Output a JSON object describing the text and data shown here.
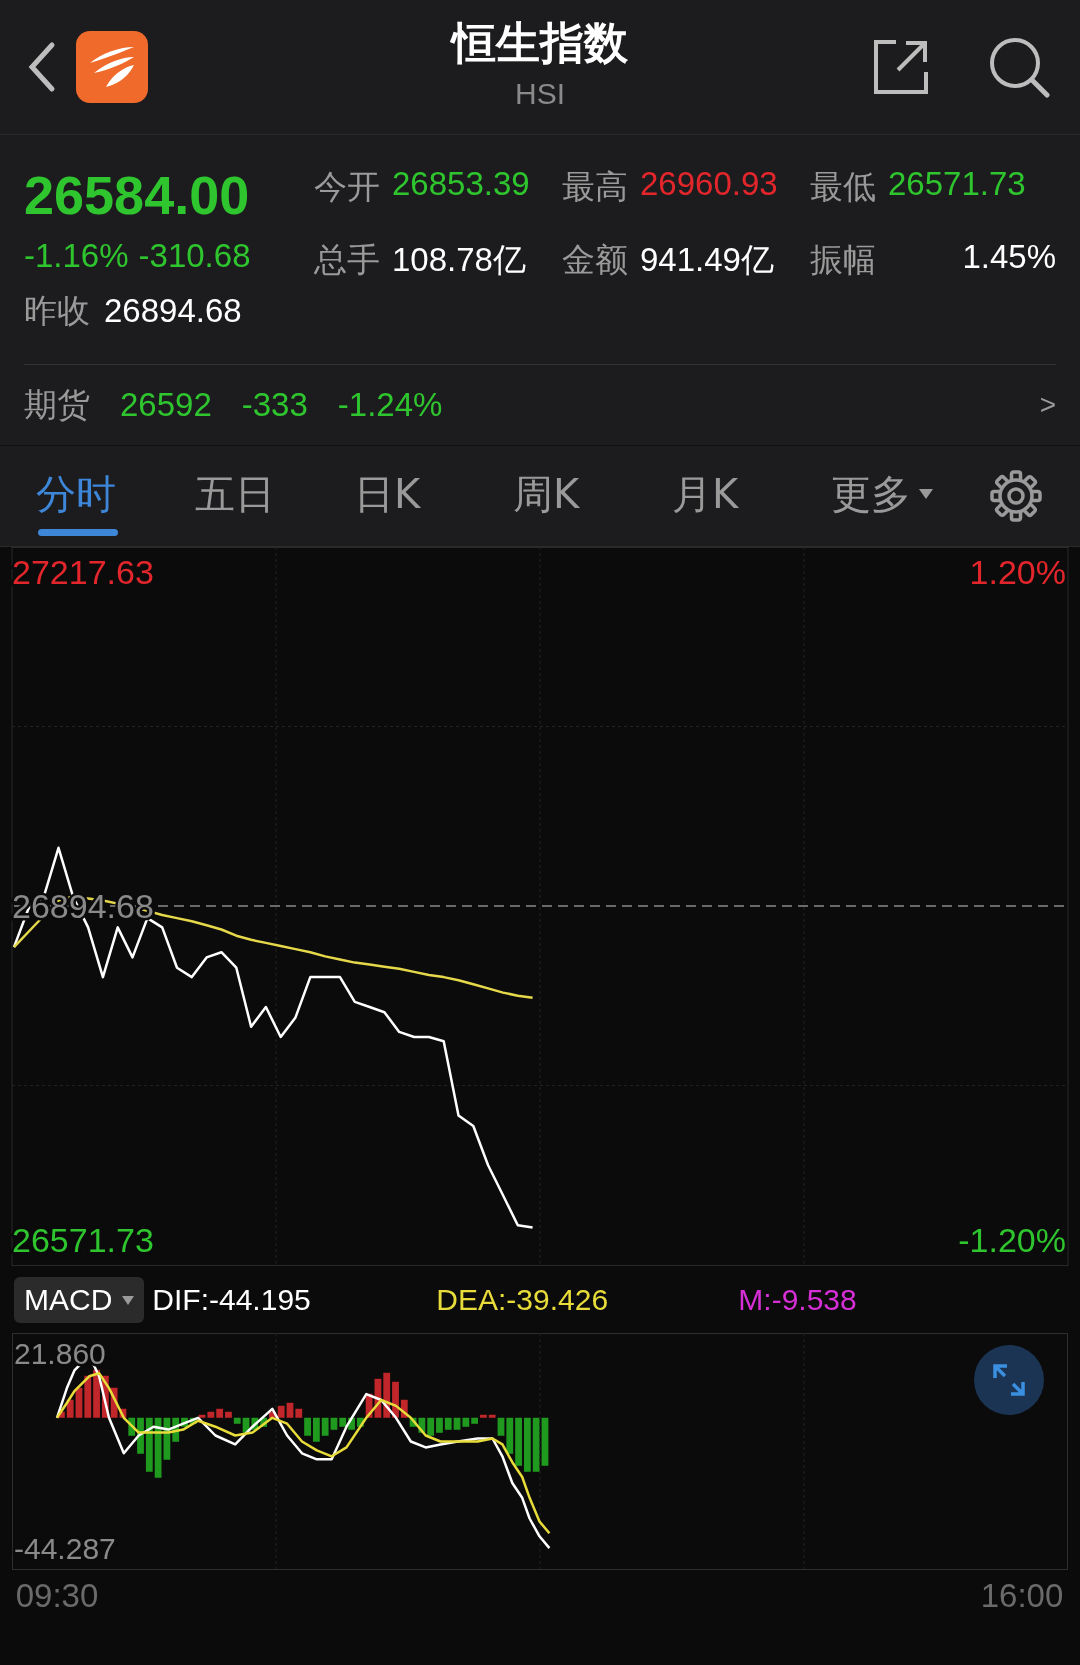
{
  "header": {
    "title": "恒生指数",
    "subtitle": "HSI"
  },
  "quote": {
    "price": "26584.00",
    "change_pct": "-1.16%",
    "change": "-310.68",
    "color": "#2ec52e",
    "prev_close_label": "昨收",
    "prev_close": "26894.68",
    "stats": [
      {
        "label": "今开",
        "value": "26853.39",
        "color": "#2ec52e"
      },
      {
        "label": "最高",
        "value": "26960.93",
        "color": "#e3262b"
      },
      {
        "label": "最低",
        "value": "26571.73",
        "color": "#2ec52e"
      },
      {
        "label": "总手",
        "value": "108.78亿",
        "color": "#ffffff"
      },
      {
        "label": "金额",
        "value": "941.49亿",
        "color": "#ffffff"
      },
      {
        "label": "振幅",
        "value": "1.45%",
        "color": "#ffffff"
      }
    ]
  },
  "futures": {
    "label": "期货",
    "price": "26592",
    "change": "-333",
    "change_pct": "-1.24%",
    "color": "#2ec52e",
    "arrow": ">"
  },
  "tabs": [
    {
      "label": "分时",
      "selected": true,
      "dropdown": false
    },
    {
      "label": "五日",
      "selected": false,
      "dropdown": false
    },
    {
      "label": "日K",
      "selected": false,
      "dropdown": false
    },
    {
      "label": "周K",
      "selected": false,
      "dropdown": false
    },
    {
      "label": "月K",
      "selected": false,
      "dropdown": false
    },
    {
      "label": "更多",
      "selected": false,
      "dropdown": true
    }
  ],
  "price_chart": {
    "chart_data": {
      "type": "line",
      "ylim": [
        26547.6,
        27241.8
      ],
      "categories": [
        null,
        null,
        null,
        null,
        null,
        null,
        null,
        null,
        null,
        null,
        null,
        null,
        null,
        null,
        null,
        null,
        null,
        null,
        null,
        null,
        null,
        null,
        null,
        null,
        null,
        null,
        null,
        null,
        null,
        null,
        null,
        null,
        null,
        null,
        null,
        null,
        null,
        null,
        null,
        null,
        null,
        null,
        null,
        null,
        null,
        null,
        null,
        null,
        null,
        null,
        null,
        null,
        null,
        null,
        null,
        null,
        null,
        null,
        null,
        null,
        null,
        null,
        null,
        null,
        null,
        null,
        null,
        null,
        null,
        null,
        null,
        null
      ],
      "series": [
        {
          "color": "#ffffff",
          "values": [
            26855,
            26893,
            26903,
            26951,
            26903,
            26874,
            26826,
            26874,
            26845,
            26883,
            26874,
            26835,
            26826,
            26845,
            26850,
            26835,
            26778,
            26797,
            26768,
            26787,
            26826,
            26826,
            26826,
            26802,
            26797,
            26792,
            26773,
            26768,
            26768,
            26764,
            26692,
            26682,
            26644,
            26615,
            26586,
            26584,
            null,
            null,
            null,
            null,
            null,
            null,
            null,
            null,
            null,
            null,
            null,
            null,
            null,
            null,
            null,
            null,
            null,
            null,
            null,
            null,
            null,
            null,
            null,
            null,
            null,
            null,
            null,
            null,
            null,
            null,
            null,
            null,
            null,
            null,
            null,
            null
          ]
        },
        {
          "color": "#e5d84a",
          "values": [
            26855,
            26870,
            26885,
            26900,
            26904,
            26902,
            26900,
            26897,
            26894,
            26890,
            26886,
            26883,
            26880,
            26876,
            26872,
            26866,
            26862,
            26859,
            26856,
            26853,
            26850,
            26846,
            26843,
            26840,
            26838,
            26836,
            26834,
            26831,
            26828,
            26826,
            26823,
            26819,
            26815,
            26811,
            26808,
            26806,
            null,
            null,
            null,
            null,
            null,
            null,
            null,
            null,
            null,
            null,
            null,
            null,
            null,
            null,
            null,
            null,
            null,
            null,
            null,
            null,
            null,
            null,
            null,
            null,
            null,
            null,
            null,
            null,
            null,
            null,
            null,
            null,
            null,
            null,
            null,
            null
          ]
        },
        {
          "color": "#8a8a8a",
          "line_style": "dashed",
          "values": [
            26894.68,
            26894.68,
            26894.68,
            26894.68,
            26894.68,
            26894.68,
            26894.68,
            26894.68,
            26894.68,
            26894.68,
            26894.68,
            26894.68,
            26894.68,
            26894.68,
            26894.68,
            26894.68,
            26894.68,
            26894.68,
            26894.68,
            26894.68,
            26894.68,
            26894.68,
            26894.68,
            26894.68,
            26894.68,
            26894.68,
            26894.68,
            26894.68,
            26894.68,
            26894.68,
            26894.68,
            26894.68,
            26894.68,
            26894.68,
            26894.68,
            26894.68,
            26894.68,
            26894.68,
            26894.68,
            26894.68,
            26894.68,
            26894.68,
            26894.68,
            26894.68,
            26894.68,
            26894.68,
            26894.68,
            26894.68,
            26894.68,
            26894.68,
            26894.68,
            26894.68,
            26894.68,
            26894.68,
            26894.68,
            26894.68,
            26894.68,
            26894.68,
            26894.68,
            26894.68,
            26894.68,
            26894.68,
            26894.68,
            26894.68,
            26894.68,
            26894.68,
            26894.68,
            26894.68,
            26894.68,
            26894.68,
            26894.68,
            26894.68
          ]
        }
      ],
      "yticks": [
        {
          "value": 27217.63,
          "label": "27217.63"
        },
        {
          "value": 26894.68,
          "label": "26894.68"
        },
        {
          "value": 26571.73,
          "label": "26571.73"
        }
      ]
    },
    "percent_labels": [
      {
        "label": "1.20%",
        "color": "#e3262b"
      },
      {
        "label": "-1.20%",
        "color": "#2ec52e"
      }
    ]
  },
  "macd": {
    "selector": "MACD",
    "readings": [
      {
        "text": "DIF:-44.195",
        "color": "#ffffff"
      },
      {
        "text": "DEA:-39.426",
        "color": "#e8dc3a"
      },
      {
        "text": "M:-9.538",
        "color": "#d62fd6"
      }
    ],
    "chart_data": {
      "type": "line",
      "xlim": [
        551.8,
        978.6
      ],
      "ylim": [
        -51.04,
        28.61
      ],
      "x": [
        570,
        574,
        577,
        583,
        587,
        591,
        597,
        603,
        609,
        615,
        621,
        627,
        634,
        642,
        649,
        657,
        663,
        669,
        675,
        681,
        687,
        695,
        701,
        707,
        713,
        719,
        725,
        732,
        740,
        746,
        750,
        754,
        758,
        761,
        765,
        769
      ],
      "series": [
        {
          "color": "#ffffff",
          "values": [
            0,
            10,
            16,
            21,
            14,
            0,
            -12,
            -6,
            -3,
            -4,
            -2,
            0,
            -6,
            -9,
            -3,
            3,
            -6,
            -12,
            -14,
            -14,
            -3,
            8,
            6,
            0,
            -8,
            -10,
            -9,
            -8,
            -7,
            -7,
            -13,
            -22,
            -27,
            -34,
            -40,
            -44
          ]
        },
        {
          "color": "#e8dc3a",
          "values": [
            0,
            5,
            9,
            14,
            15,
            10,
            0,
            -5,
            -5,
            -5,
            -4,
            -1,
            -3,
            -6,
            -5,
            0,
            -2,
            -8,
            -11,
            -13,
            -10,
            0,
            6,
            4,
            0,
            -6,
            -8,
            -8,
            -8,
            -7,
            -9,
            -15,
            -20,
            -27,
            -35,
            -39
          ]
        }
      ],
      "yticks": [
        {
          "value": 21.86,
          "label": "21.860"
        },
        {
          "value": -44.287,
          "label": "-44.287"
        }
      ],
      "xticks": [
        {
          "value": 570,
          "label": "09:30"
        },
        {
          "value": 960,
          "label": "16:00"
        }
      ]
    }
  }
}
